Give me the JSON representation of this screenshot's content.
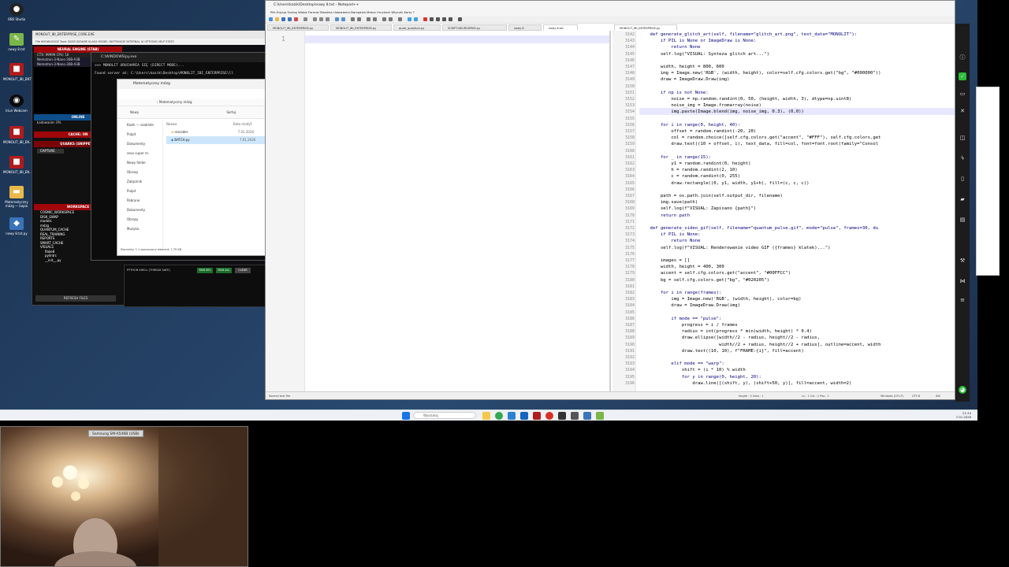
{
  "desktop": {
    "icons": [
      {
        "label": "OBS Studio"
      },
      {
        "label": "nowy 8.txt"
      },
      {
        "label": "MONOLIT_IBI_ENTERPRISE"
      },
      {
        "label": "Iriun Webcam"
      },
      {
        "label": "MONOLIT_IBI_EN..."
      },
      {
        "label": "MONOLIT_IBI_EN..."
      },
      {
        "label": "Matematyczny mózg — kopia"
      },
      {
        "label": "nowy 8.txt.py"
      }
    ]
  },
  "monolit": {
    "title": "MONOLIT_IBI_ENTERPRISE_CORE.EXE",
    "menu": "File  KNOWLEDGE  Tools  ZARZĄDZANIE  KLASA  MODEL  INSTRUKCJE  INTERNAL AI  OPTIONS  HELP  STATS",
    "engine_head": "NEURAL ENGINE (STAB)",
    "ctx_line": "CTX: 99999  CPU: 16",
    "models": [
      "Nemotron-3-Nano-30B-A3B",
      "Nemotron-3-Nano-30B-A3B"
    ],
    "status_head": "ONLINE",
    "status_line": "Ładowanie: 0%",
    "cache_head": "CACHE: ON",
    "quarks_head": "QUARKS (SNIPPETS)",
    "capture": "CAPTURE",
    "workspace_head": "WORKSPACE",
    "tree": [
      "COSMIC_WORKSPACE",
      "DISK_SWAP",
      "models",
      "mózg",
      "QUANTUM_CACHE",
      "REAL_TRAINING",
      "REPORTS",
      "SMART_CACHE",
      "VISUALS",
      "flake8",
      "pylintrc",
      "__init__.py"
    ],
    "refresh": "REFRESH FILES"
  },
  "pyshell": {
    "title": "C:\\WINDOWS\\py.exe",
    "lines": [
      ">>> MONOLIT URUCHAMIA SIĘ (DIRECT MODE)...",
      "Found server at: C:\\Users\\kazik\\Desktop\\MONOLIT_IBI_ENTERPRISE\\ll"
    ],
    "bar_title": "PYTHON SHELL (THREAD SAFE)",
    "btn_run": "RUN SEL",
    "btn_run_all": "RUN ALL",
    "btn_clear": "CLEAR"
  },
  "explorer": {
    "title": "Matematyczny mózg",
    "breadcrumb": "›  Matematyczny mózg",
    "new_btn": "Nowy",
    "sort_btn": "Sortuj",
    "sidebar": [
      "Kazik — osobiste",
      "Pulpit",
      "Dokumenty",
      "seus super m.",
      "Nowy folder",
      "Obrazy",
      "Załącznik",
      "Pulpit",
      "Pobrane",
      "Dokumenty",
      "Obrazy",
      "Muzyka"
    ],
    "col_name": "Nazwa",
    "col_date": "Data modyf.",
    "files": [
      {
        "name": "encoder",
        "date": "7.01.2026"
      },
      {
        "name": "BATCH.py",
        "date": "7.01.2026"
      }
    ],
    "status": "Elementy: 2    1 zaznaczony element: 7,79 KB"
  },
  "npp": {
    "title": "C:\\Users\\kazik\\Desktop\\nowy 8.txt - Notepad++",
    "menu": "Plik  Edycja  Szukaj  Widok  Format  Składnia  Ustawienia  Narzędzia  Makra  Uruchom  Wtyczki  Karty  ?",
    "left_tabs": [
      "MONOLIT_IBI_ENTERPRISE.py",
      "MONOLIT_IBI_ENTERPRISE.py",
      "quasi_quantum.py",
      "SCRIPT-NEUROSPIKE.py",
      "nowy 6",
      "nowy 8.txt"
    ],
    "right_tab": "MONOLIT_IBI_ENTERPRISE.py",
    "left_line_no": "1",
    "status_left": "Normal text file",
    "status_mid": "length : 0    lines : 1",
    "status_pos": "Ln : 1    Col : 1    Pos : 1",
    "status_eol": "Windows (CR LF)",
    "status_enc": "UTF-8",
    "status_ins": "INS",
    "code_lines": [
      {
        "n": "3142",
        "t": "    def generate_glitch_art(self, filename=\"glitch_art.png\", text_data=\"MONOLIT\"):"
      },
      {
        "n": "3143",
        "t": "        if PIL is None or ImageDraw is None:"
      },
      {
        "n": "3144",
        "t": "            return None"
      },
      {
        "n": "3145",
        "t": "        self.log(\"VISUAL: Synteza glitch art...\")"
      },
      {
        "n": "3146",
        "t": ""
      },
      {
        "n": "3147",
        "t": "        width, height = 800, 600"
      },
      {
        "n": "3148",
        "t": "        img = Image.new('RGB', (width, height), color=self.cfg.colors.get(\"bg\", \"#000000\"))"
      },
      {
        "n": "3149",
        "t": "        draw = ImageDraw.Draw(img)"
      },
      {
        "n": "3150",
        "t": ""
      },
      {
        "n": "3151",
        "t": "        if np is not None:"
      },
      {
        "n": "3152",
        "t": "            noise = np.random.randint(0, 50, (height, width, 3), dtype=np.uint8)"
      },
      {
        "n": "3153",
        "t": "            noise_img = Image.fromarray(noise)"
      },
      {
        "n": "3154",
        "t": "            img.paste(Image.blend(img, noise_img, 0.3), (0,0))"
      },
      {
        "n": "3155",
        "t": ""
      },
      {
        "n": "3156",
        "t": "        for i in range(0, height, 40):"
      },
      {
        "n": "3157",
        "t": "            offset = random.randint(-20, 20)"
      },
      {
        "n": "3158",
        "t": "            col = random.choice([self.cfg.colors.get(\"accent\", \"#FFF\"), self.cfg.colors.get"
      },
      {
        "n": "3159",
        "t": "            draw.text((10 + offset, i), text_data, fill=col, font=font.root(family=\"Consol"
      },
      {
        "n": "3160",
        "t": ""
      },
      {
        "n": "3161",
        "t": "        for _ in range(15):"
      },
      {
        "n": "3162",
        "t": "            y1 = random.randint(0, height)"
      },
      {
        "n": "3163",
        "t": "            h = random.randint(2, 10)"
      },
      {
        "n": "3164",
        "t": "            c = random.randint(0, 255)"
      },
      {
        "n": "3165",
        "t": "            draw.rectangle((0, y1, width, y1+h), fill=(c, c, c))"
      },
      {
        "n": "3166",
        "t": ""
      },
      {
        "n": "3167",
        "t": "        path = os.path.join(self.output_dir, filename)"
      },
      {
        "n": "3168",
        "t": "        img.save(path)"
      },
      {
        "n": "3169",
        "t": "        self.log(f\"VISUAL: Zapisano {path}\")"
      },
      {
        "n": "3170",
        "t": "        return path"
      },
      {
        "n": "3171",
        "t": ""
      },
      {
        "n": "3172",
        "t": "    def generate_video_gif(self, filename=\"quantum_pulse.gif\", mode=\"pulse\", frames=30, du"
      },
      {
        "n": "3173",
        "t": "        if PIL is None:"
      },
      {
        "n": "3174",
        "t": "            return None"
      },
      {
        "n": "3175",
        "t": "        self.log(f\"VISUAL: Renderowanie video GIF ({frames} klatek)...\")"
      },
      {
        "n": "3176",
        "t": ""
      },
      {
        "n": "3177",
        "t": "        images = []"
      },
      {
        "n": "3178",
        "t": "        width, height = 400, 300"
      },
      {
        "n": "3179",
        "t": "        accent = self.cfg.colors.get(\"accent\", \"#00FFCC\")"
      },
      {
        "n": "3180",
        "t": "        bg = self.cfg.colors.get(\"bg\", \"#020205\")"
      },
      {
        "n": "3181",
        "t": ""
      },
      {
        "n": "3182",
        "t": "        for i in range(frames):"
      },
      {
        "n": "3183",
        "t": "            img = Image.new('RGB', (width, height), color=bg)"
      },
      {
        "n": "3184",
        "t": "            draw = ImageDraw.Draw(img)"
      },
      {
        "n": "3185",
        "t": ""
      },
      {
        "n": "3186",
        "t": "            if mode == \"pulse\":"
      },
      {
        "n": "3187",
        "t": "                progress = i / frames"
      },
      {
        "n": "3188",
        "t": "                radius = int(progress * min(width, height) * 0.4)"
      },
      {
        "n": "3189",
        "t": "                draw.ellipse([width//2 - radius, height//2 - radius,"
      },
      {
        "n": "3190",
        "t": "                              width//2 + radius, height//2 + radius], outline=accent, width"
      },
      {
        "n": "3191",
        "t": "                draw.text((10, 10), f\"FRAME:{i}\", fill=accent)"
      },
      {
        "n": "3192",
        "t": ""
      },
      {
        "n": "3193",
        "t": "            elif mode == \"warp\":"
      },
      {
        "n": "3194",
        "t": "                shift = (i * 10) % width"
      },
      {
        "n": "3195",
        "t": "                for y in range(0, height, 20):"
      },
      {
        "n": "3196",
        "t": "                    draw.line([(shift, y), (shift+50, y)], fill=accent, width=2)"
      }
    ]
  },
  "taskbar": {
    "search_placeholder": "Wyszukaj",
    "date": "7.01.2026",
    "time": "21:34"
  },
  "webcam": {
    "label": "Samsung SM-A546B (USB)"
  },
  "colors": {
    "monolit_red": "#a0060a",
    "npp_highlight": "#e7e7ff",
    "keyword": "#0000ff",
    "string": "#808080"
  }
}
